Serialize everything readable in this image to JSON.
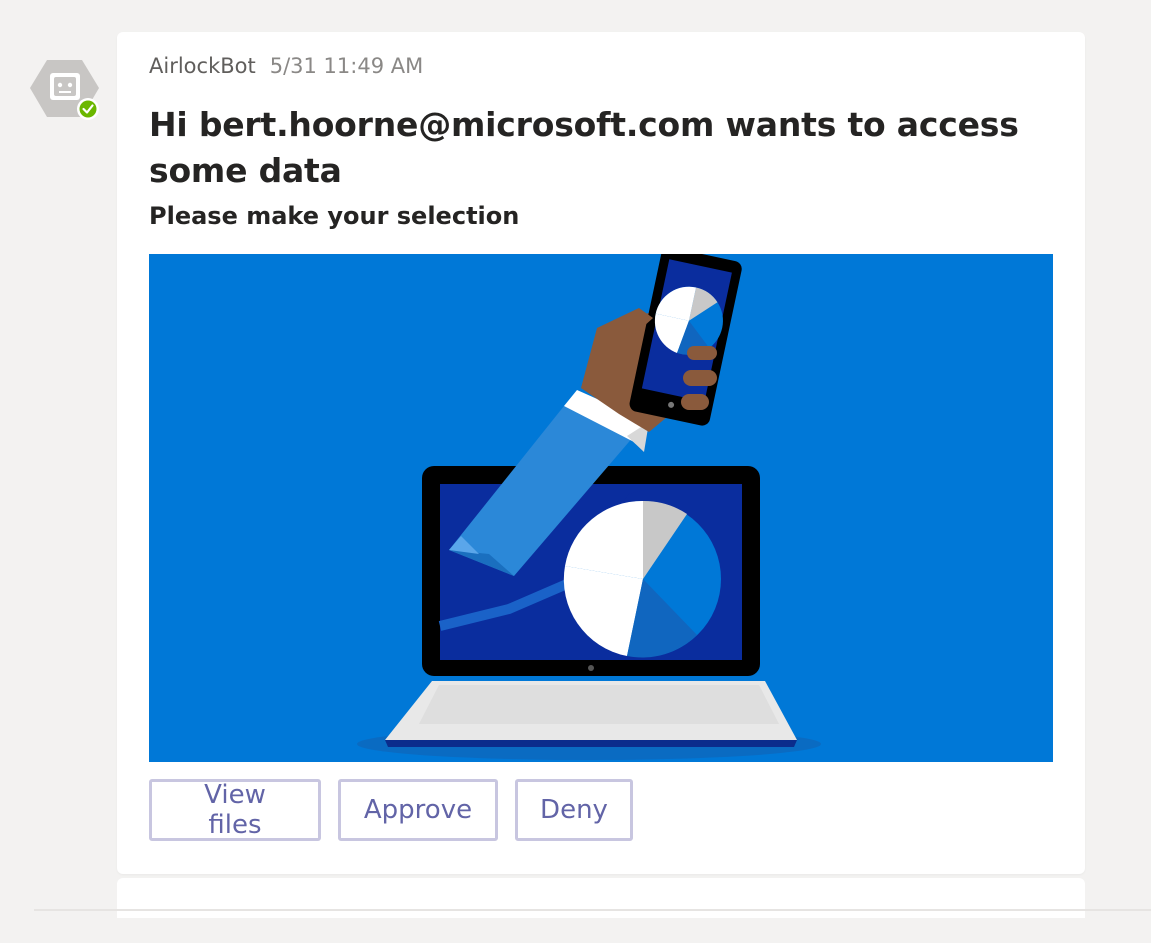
{
  "message": {
    "sender": "AirlockBot",
    "timestamp": "5/31 11:49 AM",
    "title": "Hi bert.hoorne@microsoft.com wants to access some data",
    "subtitle": "Please make your selection",
    "image_icon": "laptop-phone-pie-chart-illustration",
    "status": "available"
  },
  "actions": {
    "view_files": "View files",
    "approve": "Approve",
    "deny": "Deny"
  },
  "colors": {
    "hero_background": "#0078d7",
    "button_text": "#6264a7",
    "button_border": "#c8c6e0",
    "presence_available": "#6bb700"
  }
}
